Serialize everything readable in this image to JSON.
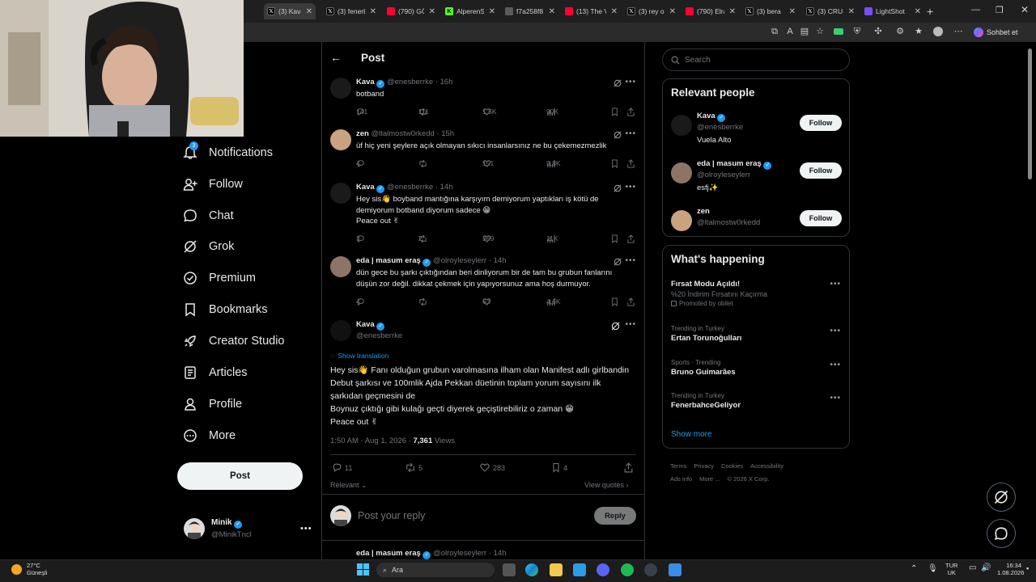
{
  "browser": {
    "tabs": [
      {
        "label": "(3) Kava o",
        "icon": "x-logo",
        "active": true
      },
      {
        "label": "(3) fenerb",
        "icon": "x-logo"
      },
      {
        "label": "(790) GÖ",
        "icon": "youtube-icon"
      },
      {
        "label": "AlperenSF",
        "icon": "kick-icon"
      },
      {
        "label": "f7a258f8",
        "icon": "globe-icon"
      },
      {
        "label": "(13) The V",
        "icon": "youtube-icon"
      },
      {
        "label": "(3) rey on",
        "icon": "x-logo"
      },
      {
        "label": "(790) Elra",
        "icon": "youtube-icon"
      },
      {
        "label": "(3) bera",
        "icon": "x-logo"
      },
      {
        "label": "(3) CRUSI",
        "icon": "x-logo"
      },
      {
        "label": "LightShot",
        "icon": "lightshot-icon"
      }
    ],
    "assistant_label": "Sohbet et"
  },
  "nav": {
    "items": [
      {
        "label": "Notifications",
        "icon": "bell-icon",
        "badge": "3"
      },
      {
        "label": "Follow",
        "icon": "person-add-icon"
      },
      {
        "label": "Chat",
        "icon": "chat-icon"
      },
      {
        "label": "Grok",
        "icon": "grok-icon"
      },
      {
        "label": "Premium",
        "icon": "premium-icon"
      },
      {
        "label": "Bookmarks",
        "icon": "bookmark-icon"
      },
      {
        "label": "Creator Studio",
        "icon": "rocket-icon"
      },
      {
        "label": "Articles",
        "icon": "article-icon"
      },
      {
        "label": "Profile",
        "icon": "profile-icon"
      },
      {
        "label": "More",
        "icon": "more-circle-icon"
      }
    ],
    "post_button": "Post",
    "account": {
      "name": "Minik",
      "handle": "@MinikTncl"
    }
  },
  "header": {
    "title": "Post"
  },
  "replies": [
    {
      "name": "Kava",
      "verified": true,
      "handle": "@enesberrke",
      "time": "16h",
      "text": "botband",
      "metrics": {
        "replies": "141",
        "reposts": "111",
        "likes": "1.5K",
        "views": "90K"
      }
    },
    {
      "name": "zen",
      "verified": false,
      "handle": "@ltalmostw0rkedd",
      "time": "15h",
      "text": "üf hiç yeni şeylere açık olmayan sıkıcı insanlarsınız ne bu çekemezmezlik",
      "metrics": {
        "replies": "4",
        "reposts": "",
        "likes": "151",
        "views": "9.8K"
      }
    },
    {
      "name": "Kava",
      "verified": true,
      "handle": "@enesberrke",
      "time": "14h",
      "text": "Hey sis👋 boyband mantığına karşıyım demiyorum yaptıkları iş kötü de demiyorum botband diyorum sadece 😁\nPeace out ✌",
      "metrics": {
        "replies": "3",
        "reposts": "2",
        "likes": "369",
        "views": "11K"
      }
    },
    {
      "name": "eda | masum eraş",
      "verified": true,
      "handle": "@olroyleseylerr",
      "time": "14h",
      "text": "dün gece bu şarkı çıktığından beri dinliyorum bir de tam bu grubun fanlarını düşün zor değil. dikkat çekmek için yapıyorsunuz ama hoş durmuyor.",
      "metrics": {
        "replies": "4",
        "reposts": "",
        "likes": "63",
        "views": "4.6K"
      }
    }
  ],
  "main_post": {
    "name": "Kava",
    "handle": "@enesberrke",
    "show_translation": "Show translation",
    "text": "Hey sis👋 Fanı olduğun grubun varolmasına ilham olan Manifest adlı girlbandin Debut şarkısı ve 100mlik Ajda Pekkan düetinin toplam yorum sayısını ilk şarkıdan geçmesini de\nBoynuz çıktığı gibi kulağı geçti diyerek geçiştirebiliriz o zaman 😁\nPeace out ✌",
    "timestamp": "1:50 AM · Aug 1, 2026 · ",
    "views": "7,361",
    "views_label": " Views",
    "metrics": {
      "replies": "11",
      "reposts": "5",
      "likes": "283",
      "bookmarks": "4"
    },
    "sort_label": "Relevant",
    "view_quotes": "View quotes"
  },
  "composer": {
    "placeholder": "Post your reply",
    "button": "Reply"
  },
  "next_reply": {
    "name": "eda | masum eraş",
    "handle": "@olroyleseylerr",
    "time": "14h"
  },
  "sidebar": {
    "search_placeholder": "Search",
    "relevant_title": "Relevant people",
    "people": [
      {
        "name": "Kava",
        "handle": "@enesberrke",
        "bio": "Vuela Alto",
        "verified": true,
        "button": "Follow"
      },
      {
        "name": "eda | masum eraş",
        "handle": "@olroyleseylerr",
        "bio": "esfj✨",
        "verified": true,
        "button": "Follow"
      },
      {
        "name": "zen",
        "handle": "@ltalmostw0rkedd",
        "bio": "",
        "verified": false,
        "button": "Follow"
      }
    ],
    "happening_title": "What's happening",
    "trends": [
      {
        "meta": "",
        "name": "Fırsat Modu Açıldı!",
        "sub": "%20 İndirim Fırsatını Kaçırma",
        "promo": "Promoted by obilet"
      },
      {
        "meta": "Trending in Turkey",
        "name": "Ertan Torunoğulları"
      },
      {
        "meta": "Sports · Trending",
        "name": "Bruno Guimarães"
      },
      {
        "meta": "Trending in Turkey",
        "name": "FenerbahceGeliyor"
      }
    ],
    "show_more": "Show more",
    "footer": [
      "Terms",
      "Privacy",
      "Cookies",
      "Accessibility",
      "Ads info",
      "More ...",
      "© 2026 X Corp."
    ]
  },
  "taskbar": {
    "weather_temp": "27°C",
    "weather_desc": "Güneşli",
    "search_label": "Ara",
    "lang_top": "TUR",
    "lang_bottom": "UK",
    "time": "16:34",
    "date": "1.08.2026"
  }
}
